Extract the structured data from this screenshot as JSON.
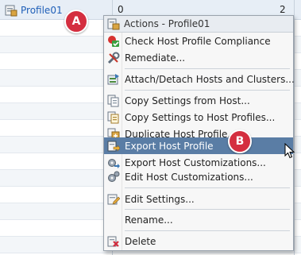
{
  "table": {
    "profile_name": "Profile01",
    "col2_value": "0",
    "col3_value": "2"
  },
  "callouts": {
    "a": "A",
    "b": "B"
  },
  "menu": {
    "header": "Actions - Profile01",
    "items": [
      {
        "label": "Check Host Profile Compliance",
        "icon": "compliance-check-icon"
      },
      {
        "label": "Remediate...",
        "icon": "remediate-tools-icon"
      },
      {
        "label": "Attach/Detach Hosts and Clusters...",
        "icon": "attach-detach-icon"
      },
      {
        "label": "Copy Settings from Host...",
        "icon": "copy-from-host-icon"
      },
      {
        "label": "Copy Settings to Host Profiles...",
        "icon": "copy-to-profiles-icon"
      },
      {
        "label": "Duplicate Host Profile...",
        "icon": "duplicate-profile-icon"
      },
      {
        "label": "Export Host Profile",
        "icon": "export-profile-icon",
        "highlighted": true
      },
      {
        "label": "Export Host Customizations...",
        "icon": "export-customizations-icon"
      },
      {
        "label": "Edit Host Customizations...",
        "icon": "edit-customizations-icon"
      },
      {
        "label": "Edit Settings...",
        "icon": "edit-settings-icon"
      },
      {
        "label": "Rename..."
      },
      {
        "label": "Delete",
        "icon": "delete-icon"
      }
    ]
  },
  "colors": {
    "highlight": "#5a7da5",
    "badge": "#d42e3f",
    "link": "#1f5fb8"
  }
}
